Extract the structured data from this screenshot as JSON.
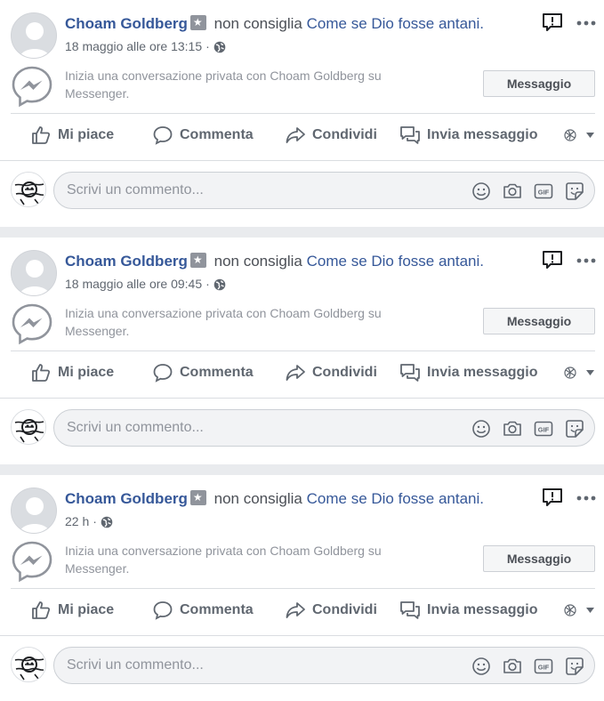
{
  "posts": [
    {
      "author": "Choam Goldberg",
      "verb": "non consiglia",
      "page": "Come se Dio fosse antani.",
      "timestamp": "18 maggio alle ore 13:15",
      "messenger_text": "Inizia una conversazione privata con Choam Goldberg su Messenger.",
      "message_button": "Messaggio",
      "actions": {
        "like": "Mi piace",
        "comment": "Commenta",
        "share": "Condividi",
        "send": "Invia messaggio"
      },
      "comment_placeholder": "Scrivi un commento..."
    },
    {
      "author": "Choam Goldberg",
      "verb": "non consiglia",
      "page": "Come se Dio fosse antani.",
      "timestamp": "18 maggio alle ore 09:45",
      "messenger_text": "Inizia una conversazione privata con Choam Goldberg su Messenger.",
      "message_button": "Messaggio",
      "actions": {
        "like": "Mi piace",
        "comment": "Commenta",
        "share": "Condividi",
        "send": "Invia messaggio"
      },
      "comment_placeholder": "Scrivi un commento..."
    },
    {
      "author": "Choam Goldberg",
      "verb": "non consiglia",
      "page": "Come se Dio fosse antani.",
      "timestamp": "22 h",
      "messenger_text": "Inizia una conversazione privata con Choam Goldberg su Messenger.",
      "message_button": "Messaggio",
      "actions": {
        "like": "Mi piace",
        "comment": "Commenta",
        "share": "Condividi",
        "send": "Invia messaggio"
      },
      "comment_placeholder": "Scrivi un commento..."
    }
  ],
  "separator": "·",
  "icons": {
    "avatar": "default-user-avatar",
    "badge": "star-badge-icon",
    "privacy": "globe-icon",
    "report": "report-icon",
    "more": "more-options-icon",
    "messenger": "messenger-icon",
    "like": "thumbs-up-icon",
    "comment": "comment-bubble-icon",
    "share": "share-arrow-icon",
    "send": "send-message-icon",
    "audience": "audience-selector-icon",
    "emoji": "emoji-icon",
    "camera": "camera-icon",
    "gif": "gif-icon",
    "sticker": "sticker-icon"
  },
  "colors": {
    "link": "#365899",
    "meta": "#606770",
    "muted": "#90949c",
    "background": "#e9ebee"
  }
}
